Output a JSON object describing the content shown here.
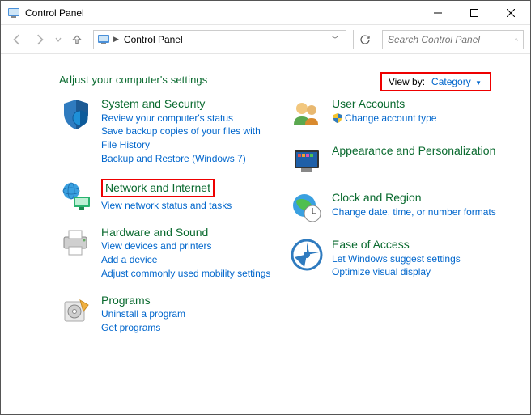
{
  "window": {
    "title": "Control Panel"
  },
  "address": {
    "crumb": "Control Panel"
  },
  "search": {
    "placeholder": "Search Control Panel"
  },
  "heading": "Adjust your computer's settings",
  "viewby": {
    "label": "View by:",
    "value": "Category"
  },
  "left": [
    {
      "title": "System and Security",
      "links": [
        "Review your computer's status",
        "Save backup copies of your files with File History",
        "Backup and Restore (Windows 7)"
      ]
    },
    {
      "title": "Network and Internet",
      "links": [
        "View network status and tasks"
      ]
    },
    {
      "title": "Hardware and Sound",
      "links": [
        "View devices and printers",
        "Add a device",
        "Adjust commonly used mobility settings"
      ]
    },
    {
      "title": "Programs",
      "links": [
        "Uninstall a program",
        "Get programs"
      ]
    }
  ],
  "right": [
    {
      "title": "User Accounts",
      "links": [
        "Change account type"
      ],
      "shield": [
        true
      ]
    },
    {
      "title": "Appearance and Personalization",
      "links": []
    },
    {
      "title": "Clock and Region",
      "links": [
        "Change date, time, or number formats"
      ]
    },
    {
      "title": "Ease of Access",
      "links": [
        "Let Windows suggest settings",
        "Optimize visual display"
      ]
    }
  ]
}
